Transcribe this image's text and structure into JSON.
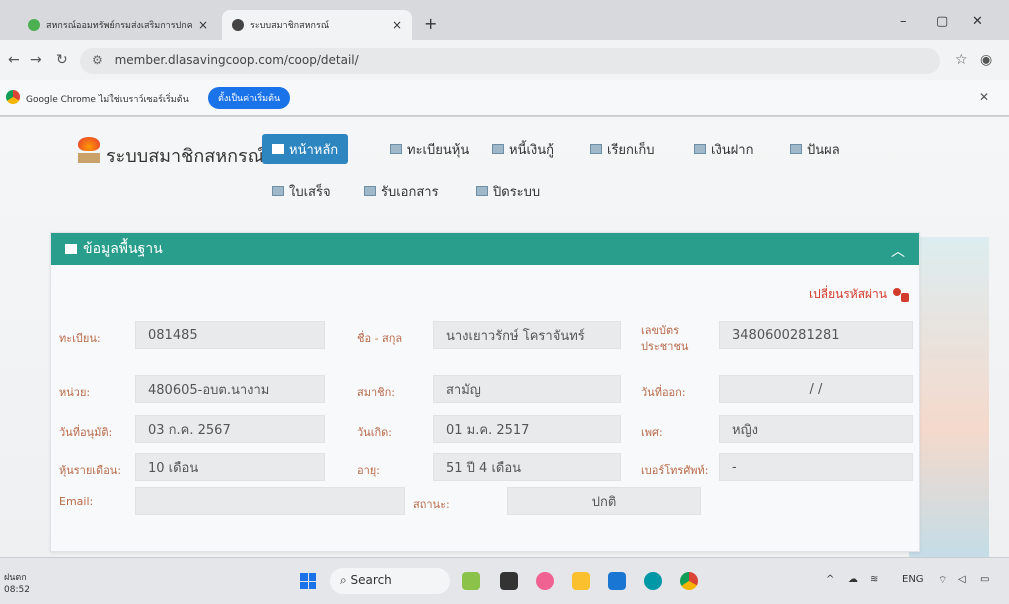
{
  "browser": {
    "tabs": [
      {
        "title": "สหกรณ์ออมทรัพย์กรมส่งเสริมการปกครองท้องถิ่น"
      },
      {
        "title": "ระบบสมาชิกสหกรณ์"
      }
    ],
    "url": "member.dlasavingcoop.com/coop/detail/",
    "infobar_message": "Google Chrome ไม่ใช่เบราว์เซอร์เริ่มต้น",
    "infobar_button": "ตั้งเป็นค่าเริ่มต้น"
  },
  "site": {
    "name": "ระบบสมาชิกสหกรณ์",
    "menu_row1": [
      {
        "label": "หน้าหลัก",
        "active": true
      },
      {
        "label": "ทะเบียนหุ้น",
        "active": false
      },
      {
        "label": "หนี้เงินกู้",
        "active": false
      },
      {
        "label": "เรียกเก็บ",
        "active": false
      },
      {
        "label": "เงินฝาก",
        "active": false
      },
      {
        "label": "ปันผล",
        "active": false
      }
    ],
    "menu_row2": [
      {
        "label": "ใบเสร็จ"
      },
      {
        "label": "รับเอกสาร"
      },
      {
        "label": "ปิดระบบ"
      }
    ]
  },
  "card": {
    "title": "ข้อมูลพื้นฐาน",
    "change_password": "เปลี่ยนรหัสผ่าน",
    "fields": {
      "reg_no_label": "ทะเบียน:",
      "reg_no": "081485",
      "name_label": "ชื่อ - สกุล",
      "name": "นางเยาวรักษ์ โคราจันทร์",
      "id_card_label": "เลขบัตรประชาชน",
      "id_card": "3480600281281",
      "unit_label": "หน่วย:",
      "unit": "480605-อบต.นางาม",
      "member_label": "สมาชิก:",
      "member": "สามัญ",
      "date_out_label": "วันที่ออก:",
      "date_out": "/ /",
      "approve_label": "วันที่อนุมัติ:",
      "approve": "03 ก.ค. 2567",
      "birth_label": "วันเกิด:",
      "birth": "01 ม.ค. 2517",
      "sex_label": "เพศ:",
      "sex": "หญิง",
      "share_label": "หุ้นรายเดือน:",
      "share": "10 เดือน",
      "age_label": "อายุ:",
      "age": "51 ปี 4 เดือน",
      "phone_label": "เบอร์โทรศัพท์:",
      "phone": "-",
      "email_label": "Email:",
      "email": "",
      "status_label": "สถานะ:",
      "status": "ปกติ"
    }
  },
  "taskbar": {
    "weather": "ฝนตก",
    "time": "08:52",
    "search": "Search",
    "lang": "ENG"
  }
}
